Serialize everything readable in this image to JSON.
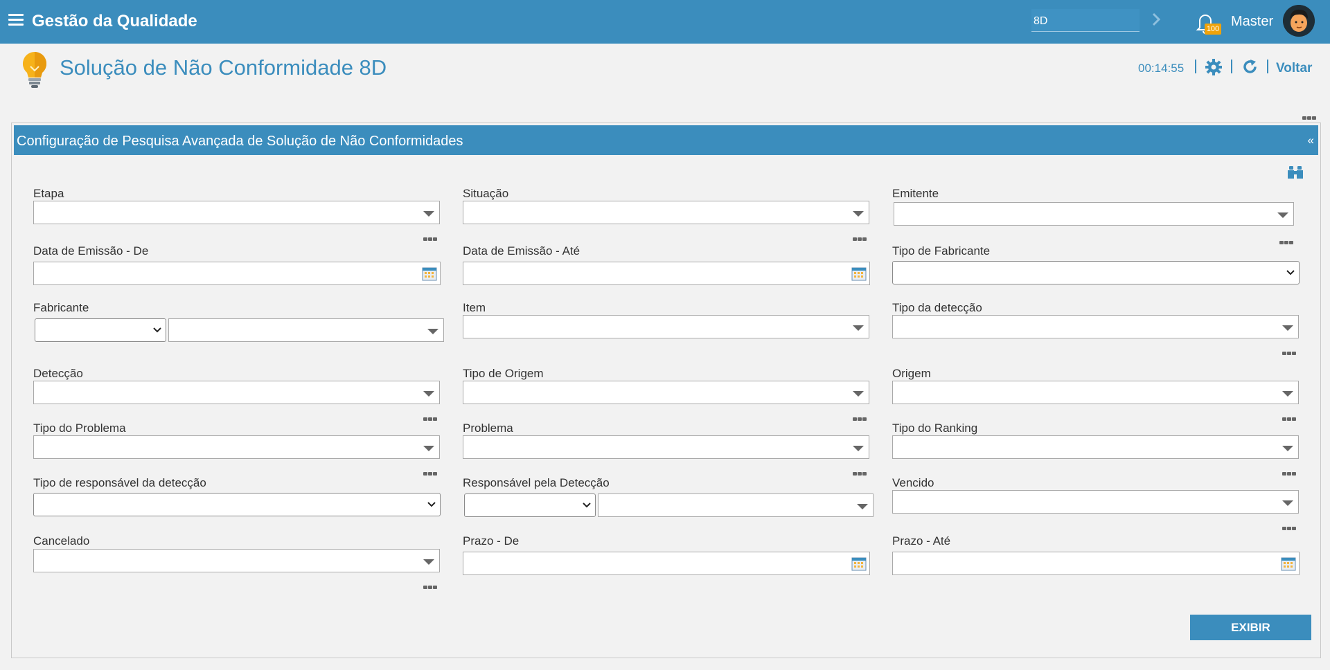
{
  "topbar": {
    "title": "Gestão da Qualidade",
    "search_value": "8D",
    "notification_count": "100",
    "user_name": "Master"
  },
  "header": {
    "page_title": "Solução de Não Conformidade 8D",
    "timer": "00:14:55",
    "back_label": "Voltar"
  },
  "panel": {
    "title": "Configuração de Pesquisa Avançada de Solução de Não Conformidades",
    "collapse_label": "«"
  },
  "fields": {
    "etapa": "Etapa",
    "situacao": "Situação",
    "emitente": "Emitente",
    "data_emissao_de": "Data de Emissão - De",
    "data_emissao_ate": "Data de Emissão - Até",
    "tipo_fabricante": "Tipo de Fabricante",
    "fabricante": "Fabricante",
    "item": "Item",
    "tipo_deteccao": "Tipo da detecção",
    "deteccao": "Detecção",
    "tipo_origem": "Tipo de Origem",
    "origem": "Origem",
    "tipo_problema": "Tipo do Problema",
    "problema": "Problema",
    "tipo_ranking": "Tipo do Ranking",
    "tipo_responsavel_deteccao": "Tipo de responsável da detecção",
    "responsavel_deteccao": "Responsável pela Detecção",
    "vencido": "Vencido",
    "cancelado": "Cancelado",
    "prazo_de": "Prazo - De",
    "prazo_ate": "Prazo - Até"
  },
  "actions": {
    "exibir_label": "EXIBIR"
  },
  "colors": {
    "primary": "#3b8dbd",
    "badge": "#f0a30a",
    "background": "#f2f2f2"
  }
}
